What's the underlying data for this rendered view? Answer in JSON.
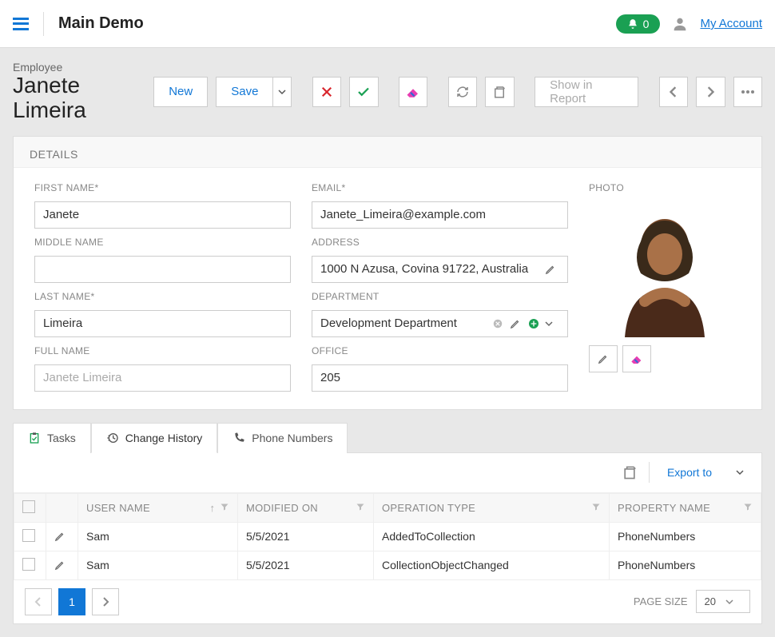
{
  "header": {
    "app_title": "Main Demo",
    "notifications_count": "0",
    "my_account": "My Account"
  },
  "page_title": {
    "type": "Employee",
    "name": "Janete Limeira"
  },
  "toolbar": {
    "new_label": "New",
    "save_label": "Save",
    "show_in_report": "Show in Report"
  },
  "details": {
    "section_label": "DETAILS",
    "labels": {
      "first_name": "FIRST NAME*",
      "middle_name": "MIDDLE NAME",
      "last_name": "LAST NAME*",
      "full_name": "FULL NAME",
      "email": "EMAIL*",
      "address": "ADDRESS",
      "department": "DEPARTMENT",
      "office": "OFFICE",
      "photo": "PHOTO"
    },
    "values": {
      "first_name": "Janete",
      "middle_name": "",
      "last_name": "Limeira",
      "full_name": "Janete Limeira",
      "email": "Janete_Limeira@example.com",
      "address": "1000 N Azusa, Covina 91722, Australia",
      "department": "Development Department",
      "office": "205"
    }
  },
  "tabs": {
    "tasks": "Tasks",
    "change_history": "Change History",
    "phone_numbers": "Phone Numbers",
    "active": "change_history"
  },
  "grid_toolbar": {
    "export_label": "Export to"
  },
  "grid": {
    "columns": {
      "user_name": "USER NAME",
      "modified_on": "MODIFIED ON",
      "operation_type": "OPERATION TYPE",
      "property_name": "PROPERTY NAME"
    },
    "rows": [
      {
        "user_name": "Sam",
        "modified_on": "5/5/2021",
        "operation_type": "AddedToCollection",
        "property_name": "PhoneNumbers"
      },
      {
        "user_name": "Sam",
        "modified_on": "5/5/2021",
        "operation_type": "CollectionObjectChanged",
        "property_name": "PhoneNumbers"
      }
    ]
  },
  "pager": {
    "current_page": "1",
    "page_size_label": "PAGE SIZE",
    "page_size_value": "20"
  }
}
